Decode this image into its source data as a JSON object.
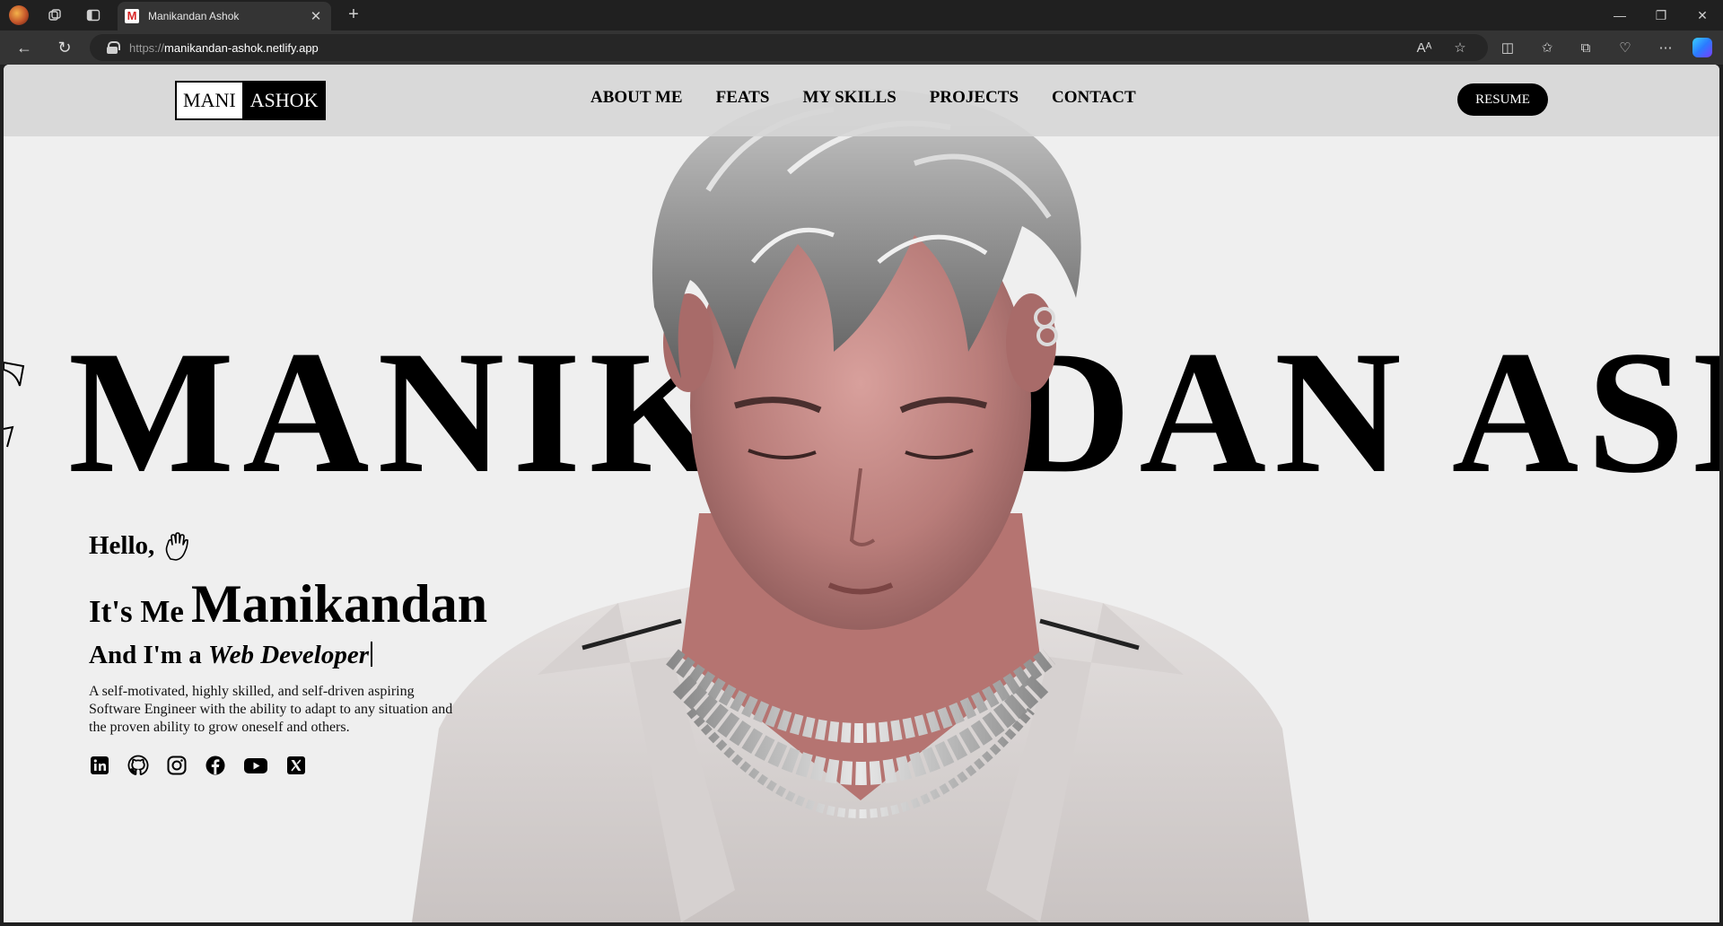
{
  "browser": {
    "tab_title": "Manikandan Ashok",
    "favicon_letter": "M",
    "url_prefix": "https://",
    "url_host": "manikandan-ashok.netlify.app"
  },
  "header": {
    "logo_left": "MANI",
    "logo_right": "ASHOK",
    "nav": [
      "ABOUT ME",
      "FEATS",
      "MY SKILLS",
      "PROJECTS",
      "CONTACT"
    ],
    "resume_label": "RESUME"
  },
  "hero": {
    "big_name": "MANIKANDAN ASHOK",
    "hello": "Hello,",
    "its_me": "It's Me",
    "name": "Manikandan",
    "role_prefix": "And I'm a",
    "role": "Web Developer",
    "description": "A self-motivated, highly skilled, and self-driven aspiring Software Engineer with the ability to adapt to any situation and the proven ability to grow oneself and others."
  },
  "socials": [
    "linkedin-icon",
    "github-icon",
    "instagram-icon",
    "facebook-icon",
    "youtube-icon",
    "x-twitter-icon"
  ],
  "colors": {
    "page_bg": "#efefef",
    "header_bg": "#d6d6d6",
    "accent": "#000000",
    "browser_chrome": "#202020"
  }
}
